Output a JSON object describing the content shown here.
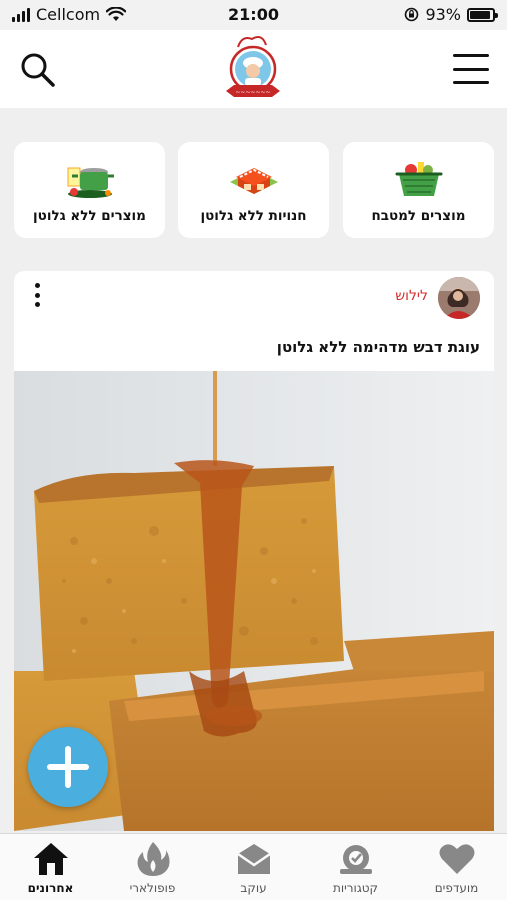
{
  "status_bar": {
    "carrier": "Cellcom",
    "time": "21:00",
    "battery": "93%",
    "battery_level": 0.93
  },
  "header": {
    "logo_icon": "chef-logo-icon",
    "search_icon": "search-icon",
    "menu_icon": "hamburger-menu-icon"
  },
  "quick_links": [
    {
      "label": "מוצרים למטבח",
      "icon": "grocery-basket-icon"
    },
    {
      "label": "חנויות ללא גלוטן",
      "icon": "store-icon"
    },
    {
      "label": "מוצרים ללא גלוטן",
      "icon": "cooking-pot-icon"
    }
  ],
  "post": {
    "author": "לילוש",
    "title": "עוגת דבש מדהימה ללא גלוטן",
    "image": "honey-cake-photo"
  },
  "bottom_nav": [
    {
      "label": "אחרונים",
      "icon": "home-icon",
      "active": true
    },
    {
      "label": "פופולארי",
      "icon": "flame-icon",
      "active": false
    },
    {
      "label": "עוקב",
      "icon": "mail-icon",
      "active": false
    },
    {
      "label": "קטגוריות",
      "icon": "categories-icon",
      "active": false
    },
    {
      "label": "מועדפים",
      "icon": "heart-icon",
      "active": false
    }
  ],
  "colors": {
    "accent": "#4aaedf",
    "author": "#d32f2f",
    "background": "#efefef"
  }
}
